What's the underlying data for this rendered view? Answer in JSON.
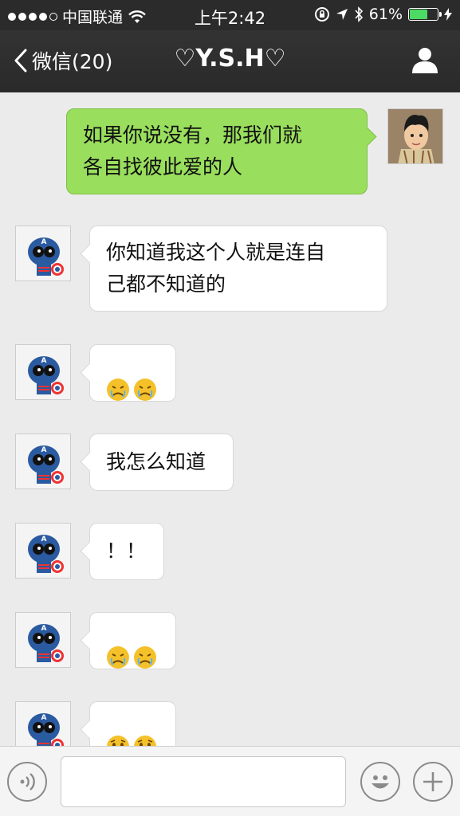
{
  "status_bar": {
    "carrier": "中国联通",
    "time": "上午2:42",
    "battery": "61%",
    "battery_level": 0.61
  },
  "nav": {
    "back_label": "微信(20)",
    "title": "♡Y.S.H♡"
  },
  "messages": [
    {
      "side": "out",
      "text": "如果你说没有，那我们就\n各自找彼此爱的人"
    },
    {
      "side": "in",
      "text": "你知道我这个人就是连自\n己都不知道的"
    },
    {
      "side": "in",
      "emoji": [
        "crying-face",
        "crying-face"
      ]
    },
    {
      "side": "in",
      "text": "我怎么知道"
    },
    {
      "side": "in",
      "text": "！！"
    },
    {
      "side": "in",
      "emoji": [
        "crying-face",
        "crying-face"
      ]
    },
    {
      "side": "in",
      "emoji": [
        "sad-face",
        "sad-face"
      ]
    }
  ],
  "colors": {
    "navbar": "#2b2b2b",
    "outgoing_bubble": "#99de5d",
    "incoming_bubble": "#ffffff",
    "chat_background": "#ebebeb"
  }
}
